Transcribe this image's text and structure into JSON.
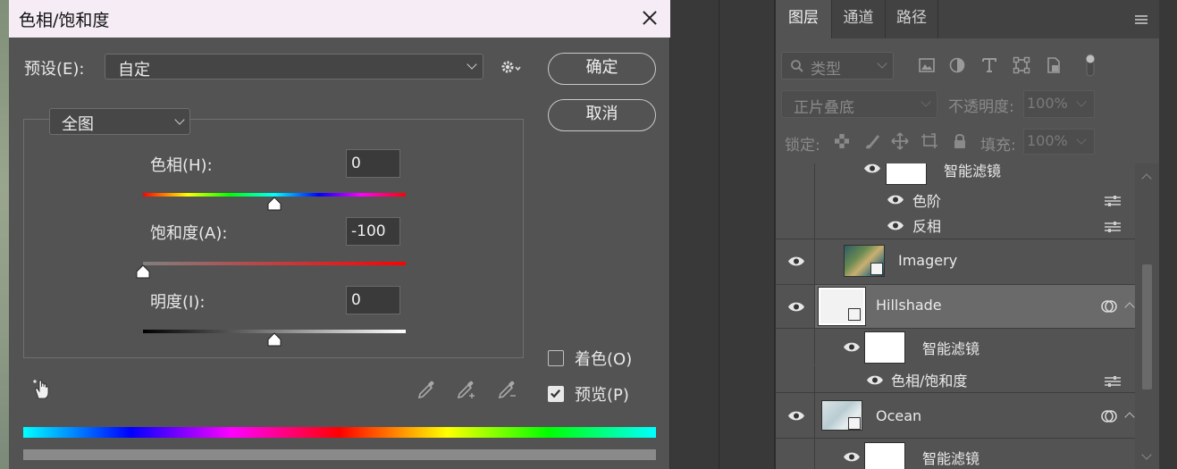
{
  "dialog": {
    "title": "色相/饱和度",
    "preset_label": "预设(E):",
    "preset_value": "自定",
    "ok_label": "确定",
    "cancel_label": "取消",
    "channel_value": "全图",
    "hue": {
      "label": "色相(H):",
      "value": "0",
      "slider_fraction": 0.5
    },
    "saturation": {
      "label": "饱和度(A):",
      "value": "-100",
      "slider_fraction": 0.0
    },
    "lightness": {
      "label": "明度(I):",
      "value": "0",
      "slider_fraction": 0.5
    },
    "colorize": {
      "label": "着色(O)",
      "checked": false
    },
    "preview": {
      "label": "预览(P)",
      "checked": true
    }
  },
  "layers_panel": {
    "tabs": [
      {
        "label": "图层",
        "active": true
      },
      {
        "label": "通道",
        "active": false
      },
      {
        "label": "路径",
        "active": false
      }
    ],
    "filter_placeholder": "类型",
    "blend_mode": "正片叠底",
    "opacity_label": "不透明度:",
    "opacity_value": "100%",
    "lock_label": "锁定:",
    "fill_label": "填充:",
    "fill_value": "100%",
    "rows": [
      {
        "kind": "filter-group",
        "name": "智能滤镜"
      },
      {
        "kind": "filter",
        "name": "色阶"
      },
      {
        "kind": "filter",
        "name": "反相"
      },
      {
        "kind": "layer",
        "name": "Imagery"
      },
      {
        "kind": "layer",
        "name": "Hillshade",
        "selected": true
      },
      {
        "kind": "filter-group",
        "name": "智能滤镜"
      },
      {
        "kind": "filter",
        "name": "色相/饱和度"
      },
      {
        "kind": "layer",
        "name": "Ocean"
      },
      {
        "kind": "filter-group",
        "name": "智能滤镜"
      }
    ]
  }
}
